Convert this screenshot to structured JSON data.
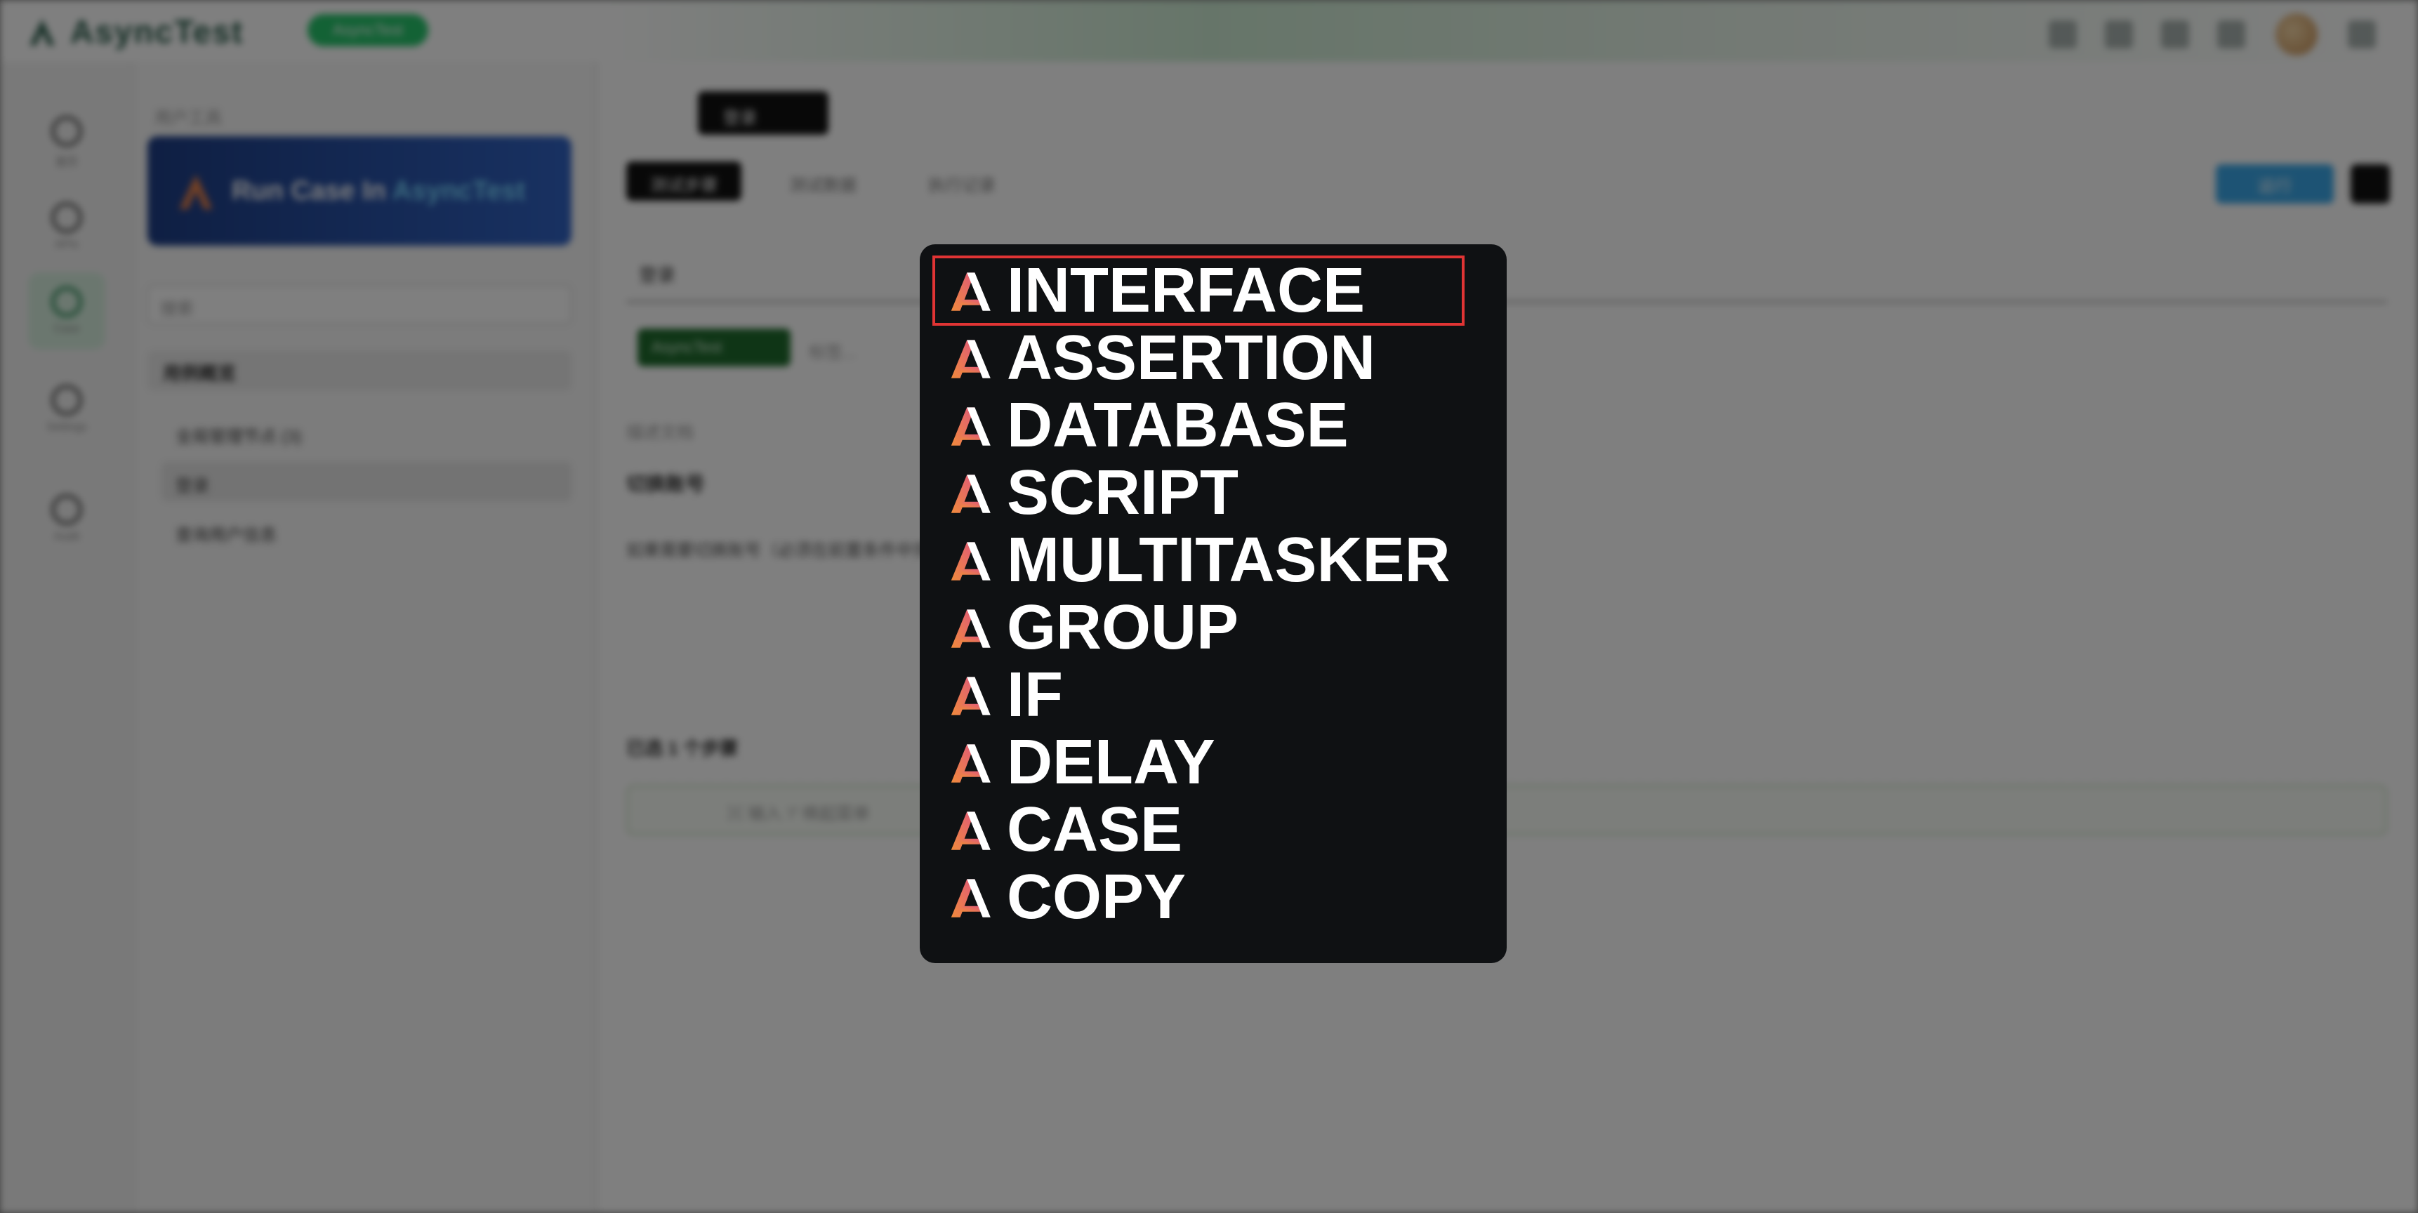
{
  "app": {
    "logo_text": "AsyncTest",
    "badge_text": "AsyncTest",
    "brand_green": "#27c46b",
    "brand_dark": "#2b5e4c"
  },
  "rail": {
    "items": [
      {
        "label": "首页",
        "icon": "home-icon"
      },
      {
        "label": "APIs",
        "icon": "api-icon"
      },
      {
        "label": "Case",
        "icon": "case-icon"
      },
      {
        "label": "Settings",
        "icon": "settings-icon"
      },
      {
        "label": "Audit",
        "icon": "audit-icon"
      }
    ]
  },
  "sidebar": {
    "caption": "用户工具",
    "banner": {
      "prefix": "Run Case In ",
      "accent": "AsyncTest"
    },
    "search_placeholder": "搜索",
    "filter_label": "用例概览",
    "tree": [
      {
        "label": "全局管理节点 (3)"
      },
      {
        "label": "登录"
      },
      {
        "label": "查询用户信息"
      }
    ]
  },
  "main": {
    "case_chip": "登录",
    "tabs": [
      {
        "label": "测试步骤"
      },
      {
        "label": "测试数据"
      },
      {
        "label": "执行记录"
      }
    ],
    "run_label": "运行",
    "section_title": "登录",
    "tag_label": "AsyncTest",
    "tag_extra": "标签...",
    "desc_label": "描述文档",
    "desc_title": "切换账号",
    "desc_text": "如果需要切换账号（必须在前置条件中完成），请在此处切换账号",
    "step_count": "已选 1 个步骤",
    "input_placeholder": "⌘ 输入 '/' 唤起菜单"
  },
  "menu": {
    "highlight_color": "#e03434",
    "items": [
      {
        "label": "INTERFACE",
        "highlighted": true
      },
      {
        "label": "ASSERTION",
        "highlighted": false
      },
      {
        "label": "DATABASE",
        "highlighted": false
      },
      {
        "label": "SCRIPT",
        "highlighted": false
      },
      {
        "label": "MULTITASKER",
        "highlighted": false
      },
      {
        "label": "GROUP",
        "highlighted": false
      },
      {
        "label": "IF",
        "highlighted": false
      },
      {
        "label": "DELAY",
        "highlighted": false
      },
      {
        "label": "CASE",
        "highlighted": false
      },
      {
        "label": "COPY",
        "highlighted": false
      }
    ]
  }
}
